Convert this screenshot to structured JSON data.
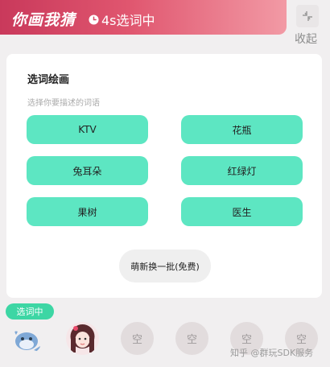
{
  "header": {
    "title": "你画我猜",
    "timer": "4s选词中",
    "collapse_label": "收起"
  },
  "panel": {
    "title": "选词绘画",
    "subtitle": "选择你要描述的词语",
    "words": [
      "KTV",
      "花瓶",
      "兔耳朵",
      "红绿灯",
      "果树",
      "医生"
    ],
    "refresh_label": "萌新换一批(免费)"
  },
  "players": {
    "status_badge": "选词中",
    "empty_slot_label": "空"
  },
  "watermark": "知乎 @群玩SDK服务",
  "colors": {
    "header_start": "#c9395b",
    "accent_green": "#5de6c2",
    "badge_green": "#3dd6a4"
  }
}
